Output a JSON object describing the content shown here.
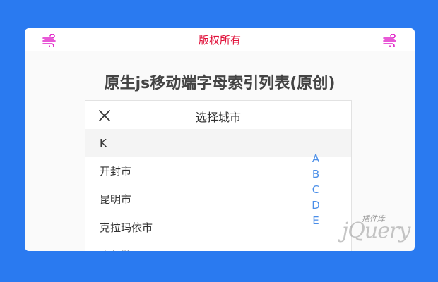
{
  "topbar": {
    "text": "版权所有",
    "accent_color": "#e0113a",
    "icon_color": "#e020c8"
  },
  "headline": "原生js移动端字母索引列表(原创)",
  "picker": {
    "title": "选择城市",
    "group_letter": "K",
    "cities": [
      "开封市",
      "昆明市",
      "克拉玛依市",
      "库尔勒"
    ]
  },
  "index_letters": [
    "A",
    "B",
    "C",
    "D",
    "E"
  ],
  "watermark": {
    "main": "jQuery",
    "sub": "插件库"
  },
  "colors": {
    "background": "#2a7af0",
    "index": "#4a8ee8"
  }
}
